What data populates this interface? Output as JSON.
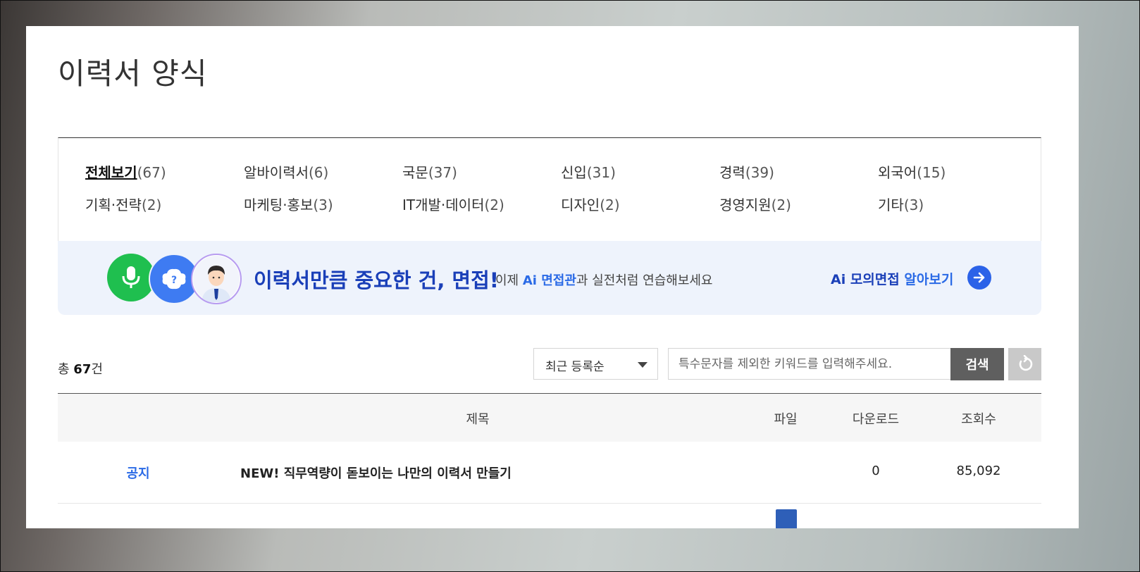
{
  "page": {
    "title": "이력서 양식"
  },
  "categories": [
    {
      "label": "전체보기",
      "count": "(67)",
      "active": true
    },
    {
      "label": "알바이력서",
      "count": "(6)"
    },
    {
      "label": "국문",
      "count": "(37)"
    },
    {
      "label": "신입",
      "count": "(31)"
    },
    {
      "label": "경력",
      "count": "(39)"
    },
    {
      "label": "외국어",
      "count": "(15)"
    },
    {
      "label": "기획·전략",
      "count": "(2)"
    },
    {
      "label": "마케팅·홍보",
      "count": "(3)"
    },
    {
      "label": "IT개발·데이터",
      "count": "(2)"
    },
    {
      "label": "디자인",
      "count": "(2)"
    },
    {
      "label": "경영지원",
      "count": "(2)"
    },
    {
      "label": "기타",
      "count": "(3)"
    }
  ],
  "banner": {
    "headline": "이력서만큼 중요한 건, 면접!",
    "sub_prefix": "이제 ",
    "sub_highlight": "Ai 면접관",
    "sub_suffix": "과 실전처럼 연습해보세요",
    "link_prefix": "Ai 모의면접 ",
    "link_highlight": "알아보기",
    "icons": [
      "mic-icon",
      "question-icon",
      "interviewer-avatar"
    ],
    "colors": {
      "mic": "#1fbf4f",
      "question": "#3e7bf2",
      "accent": "#1a3fb8"
    }
  },
  "toolbar": {
    "total_prefix": "총 ",
    "total_count": "67",
    "total_suffix": "건",
    "sort_value": "최근 등록순",
    "search_placeholder": "특수문자를 제외한 키워드를 입력해주세요.",
    "search_label": "검색",
    "reset_icon": "refresh-icon"
  },
  "table": {
    "headers": {
      "title": "제목",
      "file": "파일",
      "downloads": "다운로드",
      "views": "조회수"
    },
    "rows": [
      {
        "type": "공지",
        "title": "NEW! 직무역량이 돋보이는 나만의 이력서 만들기",
        "downloads": "0",
        "views": "85,092"
      }
    ]
  }
}
